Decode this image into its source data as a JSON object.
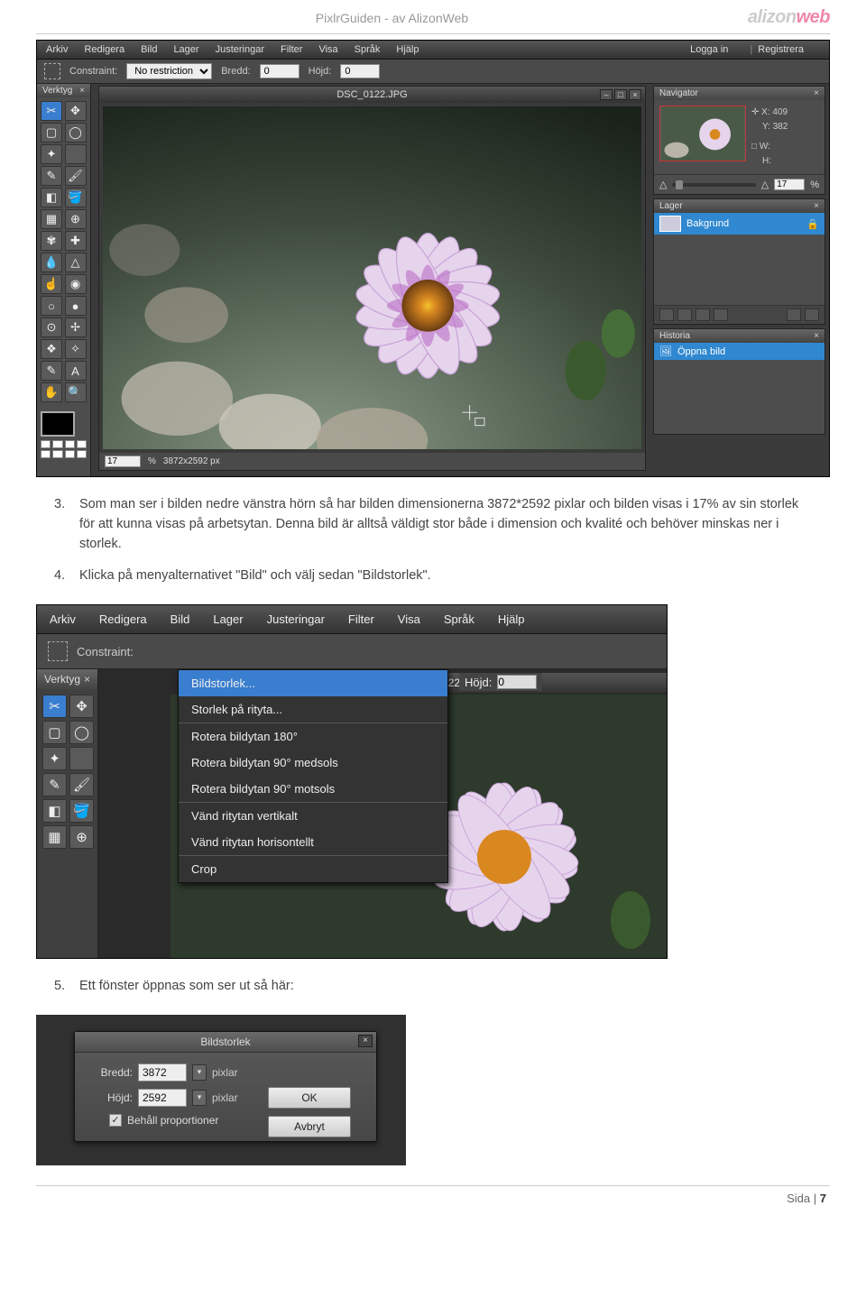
{
  "header": {
    "title": "PixlrGuiden - av AlizonWeb",
    "brand_a": "alizon",
    "brand_b": "web"
  },
  "list": {
    "item3_num": "3.",
    "item3_text": "Som man ser i bilden nedre vänstra hörn så har bilden dimensionerna 3872*2592 pixlar och bilden visas i 17% av sin storlek för att kunna visas på arbetsytan. Denna bild är alltså väldigt stor både i dimension och kvalité och behöver minskas ner i storlek.",
    "item4_num": "4.",
    "item4_text": "Klicka på menyalternativet \"Bild\" och välj sedan \"Bildstorlek\".",
    "item5_num": "5.",
    "item5_text": "Ett fönster öppnas som ser ut så här:"
  },
  "editor": {
    "menu": {
      "arkiv": "Arkiv",
      "redigera": "Redigera",
      "bild": "Bild",
      "lager": "Lager",
      "justeringar": "Justeringar",
      "filter": "Filter",
      "visa": "Visa",
      "sprak": "Språk",
      "hjalp": "Hjälp",
      "logga_in": "Logga in",
      "registrera": "Registrera"
    },
    "optbar": {
      "constraint": "Constraint:",
      "constraint_value": "No restriction",
      "bredd": "Bredd:",
      "bredd_value": "0",
      "hojd": "Höjd:",
      "hojd_value": "0"
    },
    "toolbox_title": "Verktyg",
    "doc_title": "DSC_0122.JPG",
    "status": {
      "zoom": "17",
      "pct": "%",
      "dims": "3872x2592 px"
    },
    "navigator": {
      "title": "Navigator",
      "x_label": "X:",
      "y_label": "Y:",
      "w_label": "W:",
      "h_label": "H:",
      "x": "409",
      "y": "382",
      "zoom": "17",
      "pct": "%"
    },
    "lager": {
      "title": "Lager",
      "bg": "Bakgrund"
    },
    "historia": {
      "title": "Historia",
      "open": "Öppna bild"
    }
  },
  "dropdown": {
    "i0": "Bildstorlek...",
    "i1": "Storlek på rityta...",
    "i2": "Rotera bildytan 180°",
    "i3": "Rotera bildytan 90° medsols",
    "i4": "Rotera bildytan 90° motsols",
    "i5": "Vänd ritytan vertikalt",
    "i6": "Vänd ritytan horisontellt",
    "i7": "Crop"
  },
  "dialog": {
    "title": "Bildstorlek",
    "bredd_label": "Bredd:",
    "bredd_value": "3872",
    "hojd_label": "Höjd:",
    "hojd_value": "2592",
    "unit": "pixlar",
    "keep": "Behåll proportioner",
    "ok": "OK",
    "cancel": "Avbryt"
  },
  "footer": {
    "label": "Sida",
    "sep": "|",
    "page": "7"
  }
}
